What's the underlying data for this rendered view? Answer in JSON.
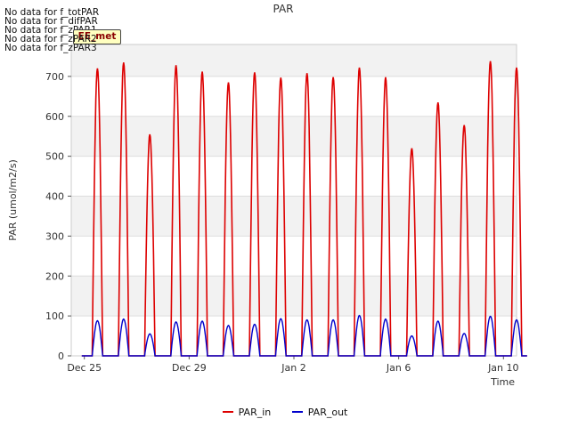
{
  "no_data_messages": [
    "No data for f_totPAR",
    "No data for f_difPAR",
    "No data for f_zPAR1",
    "No data for f_zPAR2",
    "No data for f_zPAR3"
  ],
  "badge_label": "EE_met",
  "chart_data": {
    "type": "line",
    "title": "PAR",
    "xlabel": "Time",
    "ylabel": "PAR (umol/m2/s)",
    "ylim": [
      0,
      780
    ],
    "yticks": [
      0,
      100,
      200,
      300,
      400,
      500,
      600,
      700
    ],
    "xlim_days": [
      -0.5,
      16.5
    ],
    "xticks": [
      {
        "day": 0,
        "label": "Dec 25"
      },
      {
        "day": 4,
        "label": "Dec 29"
      },
      {
        "day": 8,
        "label": "Jan 2"
      },
      {
        "day": 12,
        "label": "Jan 6"
      },
      {
        "day": 16,
        "label": "Jan 10"
      }
    ],
    "x_unit": "days since Dec 25 (daily midday peaks)",
    "grid": true,
    "legend_placement": "bottom-center",
    "series": [
      {
        "name": "PAR_in",
        "color": "#dd0000",
        "daily_peaks": [
          {
            "day": "Dec 25",
            "peak": 720
          },
          {
            "day": "Dec 26",
            "peak": 735
          },
          {
            "day": "Dec 27",
            "peak": 555
          },
          {
            "day": "Dec 28",
            "peak": 728
          },
          {
            "day": "Dec 29",
            "peak": 712
          },
          {
            "day": "Dec 30",
            "peak": 685
          },
          {
            "day": "Dec 31",
            "peak": 710
          },
          {
            "day": "Jan 1",
            "peak": 697
          },
          {
            "day": "Jan 2",
            "peak": 708
          },
          {
            "day": "Jan 3",
            "peak": 698
          },
          {
            "day": "Jan 4",
            "peak": 722
          },
          {
            "day": "Jan 5",
            "peak": 698
          },
          {
            "day": "Jan 6",
            "peak": 520
          },
          {
            "day": "Jan 7",
            "peak": 635
          },
          {
            "day": "Jan 8",
            "peak": 578
          },
          {
            "day": "Jan 9",
            "peak": 738
          },
          {
            "day": "Jan 10",
            "peak": 722
          }
        ]
      },
      {
        "name": "PAR_out",
        "color": "#0000cc",
        "daily_peaks": [
          {
            "day": "Dec 25",
            "peak": 88
          },
          {
            "day": "Dec 26",
            "peak": 92
          },
          {
            "day": "Dec 27",
            "peak": 55
          },
          {
            "day": "Dec 28",
            "peak": 85
          },
          {
            "day": "Dec 29",
            "peak": 87
          },
          {
            "day": "Dec 30",
            "peak": 76
          },
          {
            "day": "Dec 31",
            "peak": 79
          },
          {
            "day": "Jan 1",
            "peak": 93
          },
          {
            "day": "Jan 2",
            "peak": 90
          },
          {
            "day": "Jan 3",
            "peak": 90
          },
          {
            "day": "Jan 4",
            "peak": 101
          },
          {
            "day": "Jan 5",
            "peak": 92
          },
          {
            "day": "Jan 6",
            "peak": 50
          },
          {
            "day": "Jan 7",
            "peak": 87
          },
          {
            "day": "Jan 8",
            "peak": 56
          },
          {
            "day": "Jan 9",
            "peak": 99
          },
          {
            "day": "Jan 10",
            "peak": 90
          }
        ]
      }
    ]
  }
}
